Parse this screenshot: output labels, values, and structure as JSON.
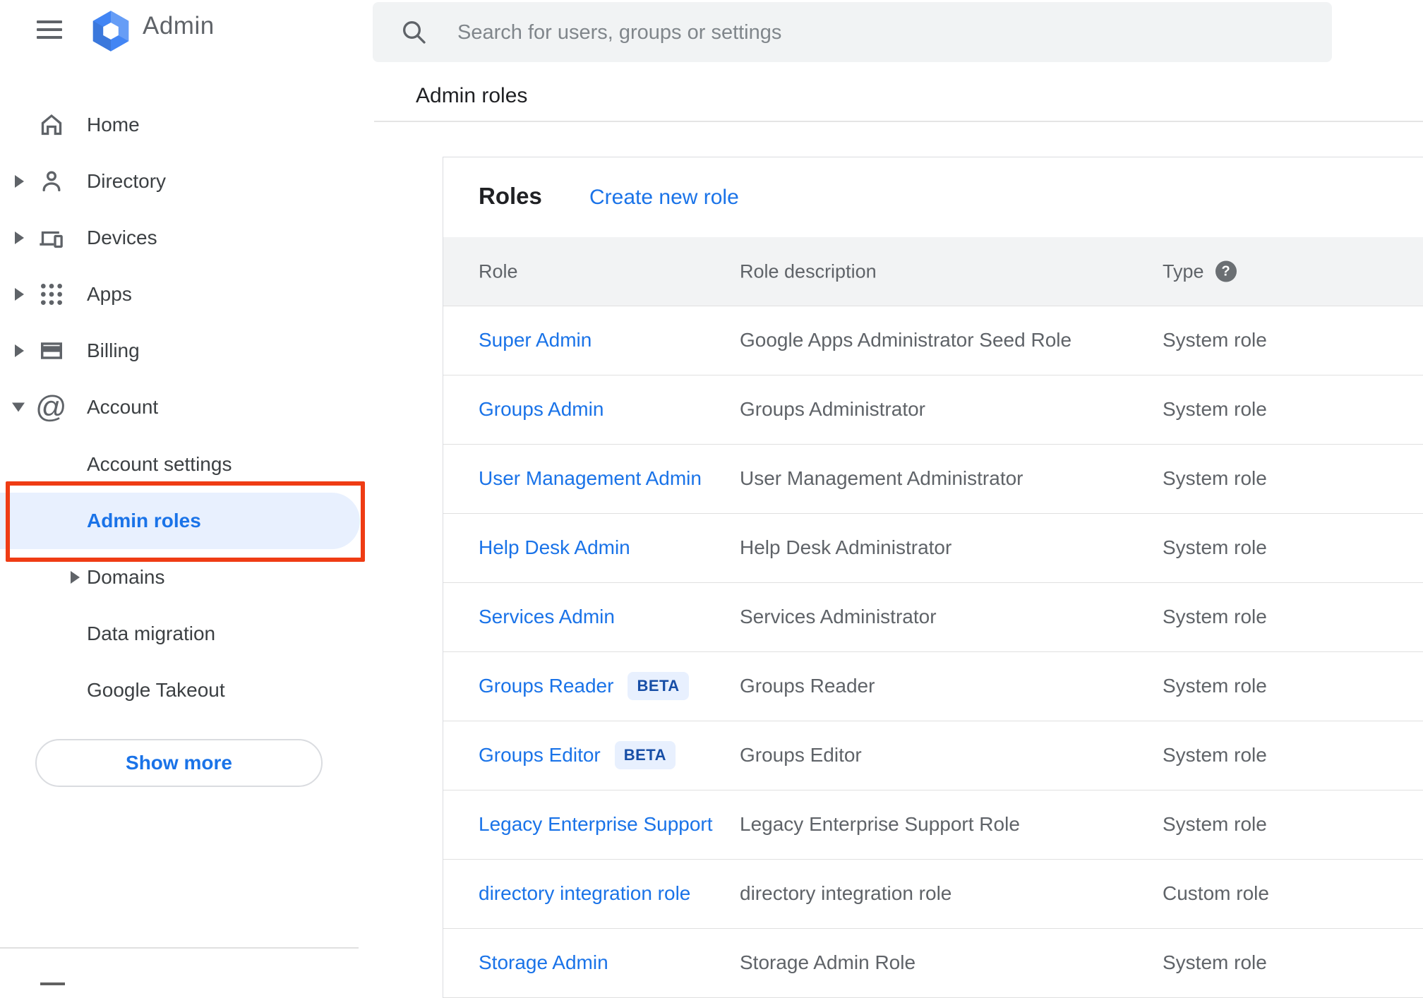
{
  "topbar": {
    "logo_text": "Admin",
    "search_placeholder": "Search for users, groups or settings"
  },
  "breadcrumb": "Admin roles",
  "sidebar": {
    "items": [
      {
        "label": "Home",
        "expandable": false
      },
      {
        "label": "Directory",
        "expandable": true
      },
      {
        "label": "Devices",
        "expandable": true
      },
      {
        "label": "Apps",
        "expandable": true
      },
      {
        "label": "Billing",
        "expandable": true
      },
      {
        "label": "Account",
        "expandable": true,
        "expanded": true
      },
      {
        "label": "Account settings",
        "sub": true
      },
      {
        "label": "Admin roles",
        "sub": true,
        "selected": true
      },
      {
        "label": "Domains",
        "sub": true,
        "expandable": true
      },
      {
        "label": "Data migration",
        "sub": true
      },
      {
        "label": "Google Takeout",
        "sub": true
      }
    ],
    "show_more_label": "Show more"
  },
  "panel": {
    "title": "Roles",
    "create_link": "Create new role",
    "beta_label": "BETA",
    "columns": {
      "role": "Role",
      "description": "Role description",
      "type": "Type"
    },
    "rows": [
      {
        "role": "Super Admin",
        "beta": false,
        "description": "Google Apps Administrator Seed Role",
        "type": "System role"
      },
      {
        "role": "Groups Admin",
        "beta": false,
        "description": "Groups Administrator",
        "type": "System role"
      },
      {
        "role": "User Management Admin",
        "beta": false,
        "description": "User Management Administrator",
        "type": "System role"
      },
      {
        "role": "Help Desk Admin",
        "beta": false,
        "description": "Help Desk Administrator",
        "type": "System role"
      },
      {
        "role": "Services Admin",
        "beta": false,
        "description": "Services Administrator",
        "type": "System role"
      },
      {
        "role": "Groups Reader",
        "beta": true,
        "description": "Groups Reader",
        "type": "System role"
      },
      {
        "role": "Groups Editor",
        "beta": true,
        "description": "Groups Editor",
        "type": "System role"
      },
      {
        "role": "Legacy Enterprise Support",
        "beta": false,
        "description": "Legacy Enterprise Support Role",
        "type": "System role"
      },
      {
        "role": "directory integration role",
        "beta": false,
        "description": "directory integration role",
        "type": "Custom role"
      },
      {
        "role": "Storage Admin",
        "beta": false,
        "description": "Storage Admin Role",
        "type": "System role"
      }
    ]
  },
  "colors": {
    "link_blue": "#1a73e8",
    "selected_bg": "#e8f0fe",
    "beta_text": "#174ea6",
    "annotation_red": "#ef3c14",
    "search_bg": "#f1f3f4",
    "header_band_bg": "#f2f3f4",
    "logo_blue": "#4285f4"
  }
}
